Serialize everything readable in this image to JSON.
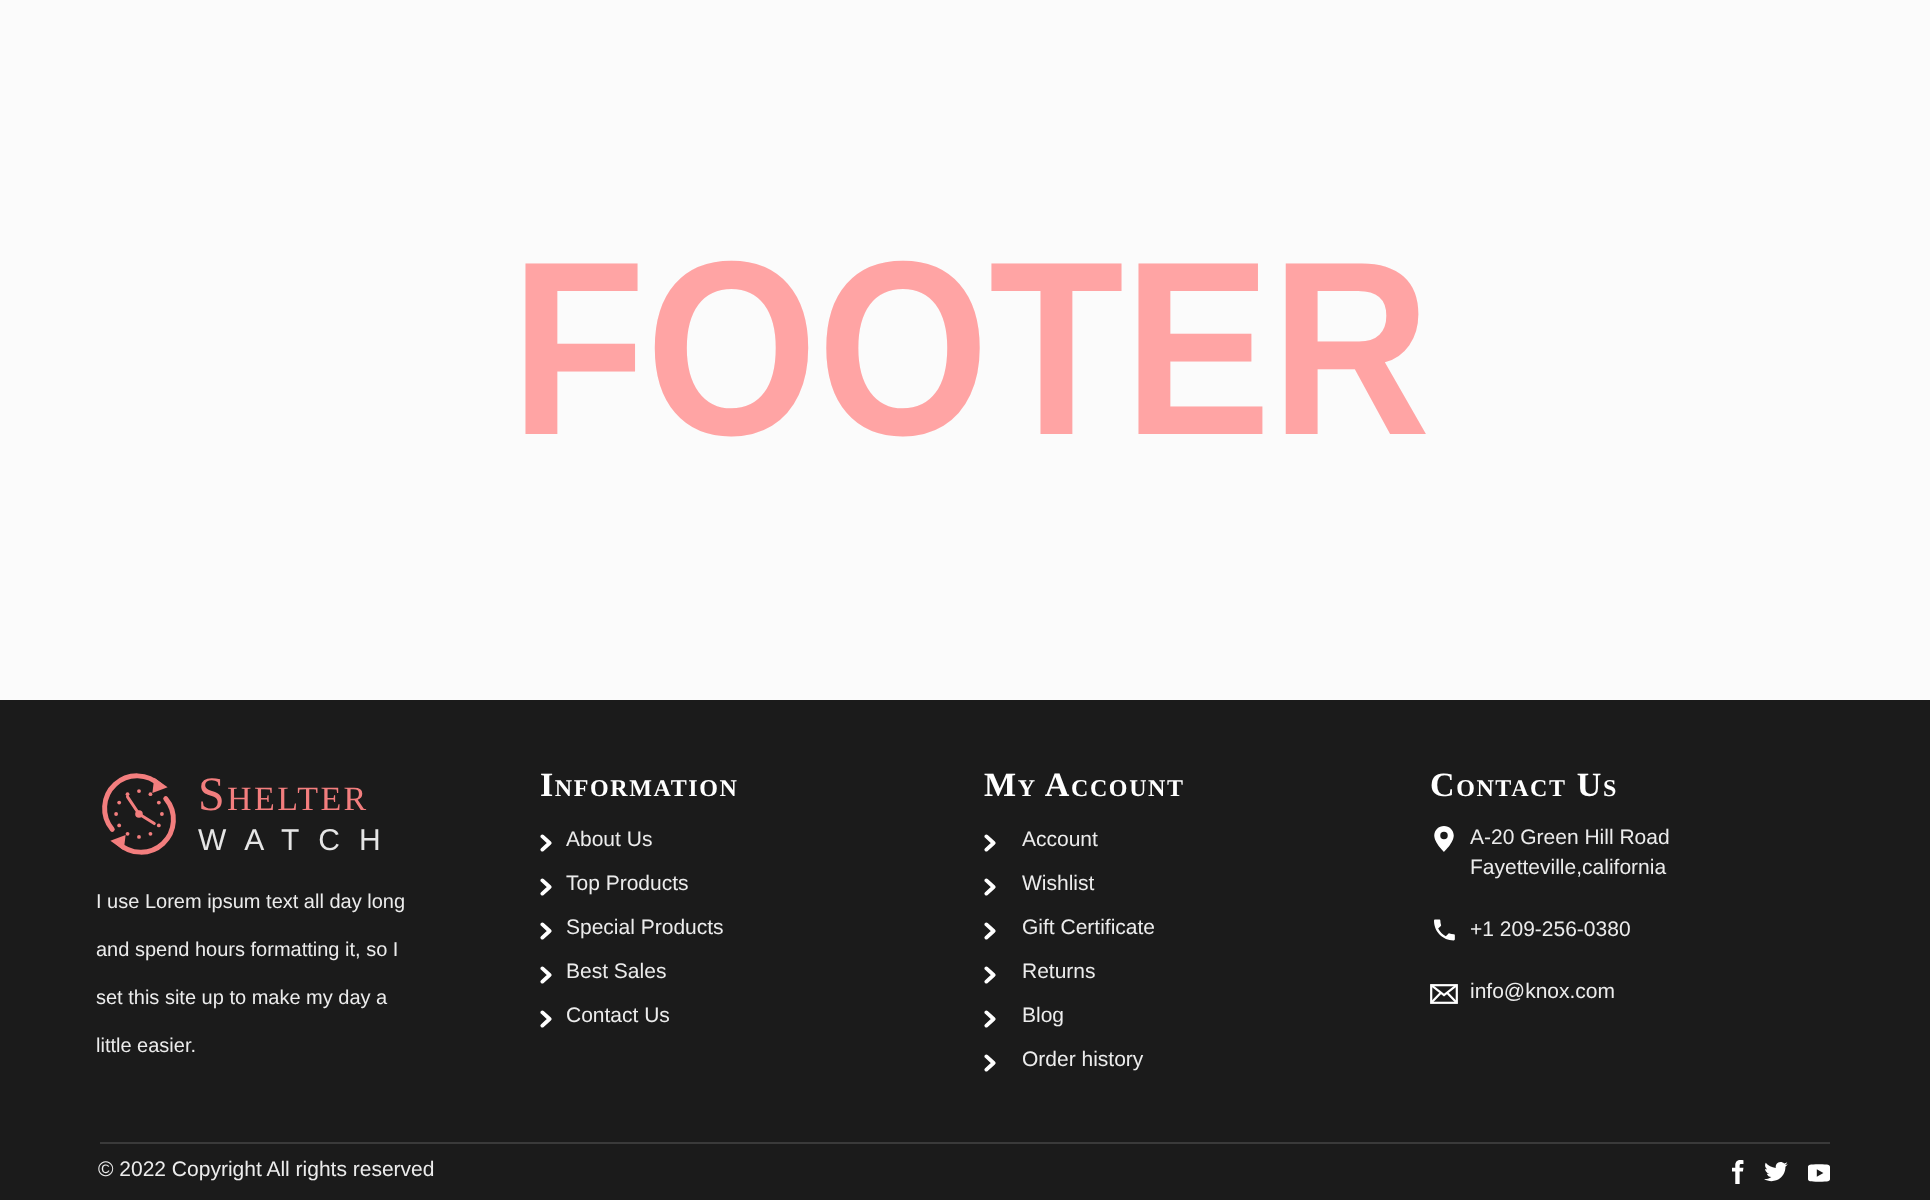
{
  "hero": {
    "title": "FOOTER"
  },
  "brand": {
    "name": "Shelter",
    "tagline": "WATCH",
    "about": "I use Lorem ipsum text all day long and spend hours formatting it, so I set this site up to make my day a little easier."
  },
  "columns": [
    {
      "heading": "Information",
      "links": [
        "About Us",
        "Top Products",
        "Special Products",
        "Best Sales",
        "Contact Us"
      ]
    },
    {
      "heading": "My Account",
      "links": [
        "Account",
        "Wishlist",
        "Gift Certificate",
        "Returns",
        "Blog",
        "Order history"
      ]
    }
  ],
  "contact": {
    "heading": "Contact Us",
    "items": [
      {
        "kind": "address",
        "lines": [
          "A-20 Green Hill Road",
          "Fayetteville,california"
        ]
      },
      {
        "kind": "phone",
        "lines": [
          "+1 209-256-0380"
        ]
      },
      {
        "kind": "email",
        "lines": [
          "info@knox.com"
        ]
      }
    ]
  },
  "bottom_bar": {
    "copyright": "© 2022 Copyright All rights reserved",
    "social": [
      {
        "kind": "facebook"
      },
      {
        "kind": "twitter"
      },
      {
        "kind": "youtube"
      }
    ]
  }
}
